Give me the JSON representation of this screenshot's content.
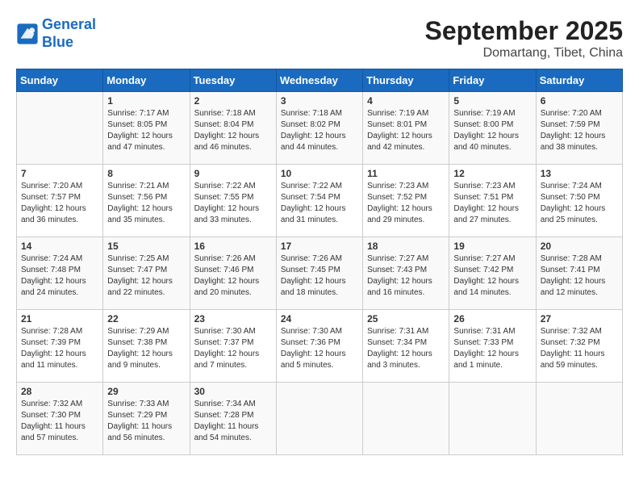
{
  "header": {
    "logo_line1": "General",
    "logo_line2": "Blue",
    "month": "September 2025",
    "location": "Domartang, Tibet, China"
  },
  "days_of_week": [
    "Sunday",
    "Monday",
    "Tuesday",
    "Wednesday",
    "Thursday",
    "Friday",
    "Saturday"
  ],
  "weeks": [
    [
      {
        "num": "",
        "info": ""
      },
      {
        "num": "1",
        "info": "Sunrise: 7:17 AM\nSunset: 8:05 PM\nDaylight: 12 hours\nand 47 minutes."
      },
      {
        "num": "2",
        "info": "Sunrise: 7:18 AM\nSunset: 8:04 PM\nDaylight: 12 hours\nand 46 minutes."
      },
      {
        "num": "3",
        "info": "Sunrise: 7:18 AM\nSunset: 8:02 PM\nDaylight: 12 hours\nand 44 minutes."
      },
      {
        "num": "4",
        "info": "Sunrise: 7:19 AM\nSunset: 8:01 PM\nDaylight: 12 hours\nand 42 minutes."
      },
      {
        "num": "5",
        "info": "Sunrise: 7:19 AM\nSunset: 8:00 PM\nDaylight: 12 hours\nand 40 minutes."
      },
      {
        "num": "6",
        "info": "Sunrise: 7:20 AM\nSunset: 7:59 PM\nDaylight: 12 hours\nand 38 minutes."
      }
    ],
    [
      {
        "num": "7",
        "info": "Sunrise: 7:20 AM\nSunset: 7:57 PM\nDaylight: 12 hours\nand 36 minutes."
      },
      {
        "num": "8",
        "info": "Sunrise: 7:21 AM\nSunset: 7:56 PM\nDaylight: 12 hours\nand 35 minutes."
      },
      {
        "num": "9",
        "info": "Sunrise: 7:22 AM\nSunset: 7:55 PM\nDaylight: 12 hours\nand 33 minutes."
      },
      {
        "num": "10",
        "info": "Sunrise: 7:22 AM\nSunset: 7:54 PM\nDaylight: 12 hours\nand 31 minutes."
      },
      {
        "num": "11",
        "info": "Sunrise: 7:23 AM\nSunset: 7:52 PM\nDaylight: 12 hours\nand 29 minutes."
      },
      {
        "num": "12",
        "info": "Sunrise: 7:23 AM\nSunset: 7:51 PM\nDaylight: 12 hours\nand 27 minutes."
      },
      {
        "num": "13",
        "info": "Sunrise: 7:24 AM\nSunset: 7:50 PM\nDaylight: 12 hours\nand 25 minutes."
      }
    ],
    [
      {
        "num": "14",
        "info": "Sunrise: 7:24 AM\nSunset: 7:48 PM\nDaylight: 12 hours\nand 24 minutes."
      },
      {
        "num": "15",
        "info": "Sunrise: 7:25 AM\nSunset: 7:47 PM\nDaylight: 12 hours\nand 22 minutes."
      },
      {
        "num": "16",
        "info": "Sunrise: 7:26 AM\nSunset: 7:46 PM\nDaylight: 12 hours\nand 20 minutes."
      },
      {
        "num": "17",
        "info": "Sunrise: 7:26 AM\nSunset: 7:45 PM\nDaylight: 12 hours\nand 18 minutes."
      },
      {
        "num": "18",
        "info": "Sunrise: 7:27 AM\nSunset: 7:43 PM\nDaylight: 12 hours\nand 16 minutes."
      },
      {
        "num": "19",
        "info": "Sunrise: 7:27 AM\nSunset: 7:42 PM\nDaylight: 12 hours\nand 14 minutes."
      },
      {
        "num": "20",
        "info": "Sunrise: 7:28 AM\nSunset: 7:41 PM\nDaylight: 12 hours\nand 12 minutes."
      }
    ],
    [
      {
        "num": "21",
        "info": "Sunrise: 7:28 AM\nSunset: 7:39 PM\nDaylight: 12 hours\nand 11 minutes."
      },
      {
        "num": "22",
        "info": "Sunrise: 7:29 AM\nSunset: 7:38 PM\nDaylight: 12 hours\nand 9 minutes."
      },
      {
        "num": "23",
        "info": "Sunrise: 7:30 AM\nSunset: 7:37 PM\nDaylight: 12 hours\nand 7 minutes."
      },
      {
        "num": "24",
        "info": "Sunrise: 7:30 AM\nSunset: 7:36 PM\nDaylight: 12 hours\nand 5 minutes."
      },
      {
        "num": "25",
        "info": "Sunrise: 7:31 AM\nSunset: 7:34 PM\nDaylight: 12 hours\nand 3 minutes."
      },
      {
        "num": "26",
        "info": "Sunrise: 7:31 AM\nSunset: 7:33 PM\nDaylight: 12 hours\nand 1 minute."
      },
      {
        "num": "27",
        "info": "Sunrise: 7:32 AM\nSunset: 7:32 PM\nDaylight: 11 hours\nand 59 minutes."
      }
    ],
    [
      {
        "num": "28",
        "info": "Sunrise: 7:32 AM\nSunset: 7:30 PM\nDaylight: 11 hours\nand 57 minutes."
      },
      {
        "num": "29",
        "info": "Sunrise: 7:33 AM\nSunset: 7:29 PM\nDaylight: 11 hours\nand 56 minutes."
      },
      {
        "num": "30",
        "info": "Sunrise: 7:34 AM\nSunset: 7:28 PM\nDaylight: 11 hours\nand 54 minutes."
      },
      {
        "num": "",
        "info": ""
      },
      {
        "num": "",
        "info": ""
      },
      {
        "num": "",
        "info": ""
      },
      {
        "num": "",
        "info": ""
      }
    ]
  ]
}
